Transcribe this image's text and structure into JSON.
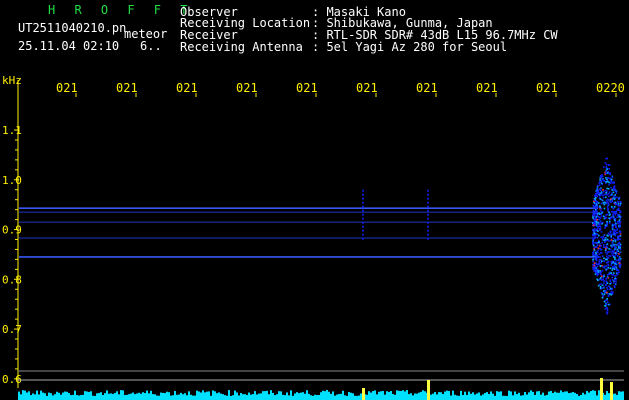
{
  "header": {
    "brand": "H R O F F T",
    "filename": "UT2511040210.pn",
    "kind": "meteor",
    "datetime": "25.11.04 02:10",
    "count": "6..",
    "info": [
      {
        "label": "Observer",
        "value": ": Masaki Kano"
      },
      {
        "label": "Receiving Location",
        "value": ": Shibukawa, Gunma, Japan"
      },
      {
        "label": "Receiver",
        "value": ": RTL-SDR SDR# 43dB L15 96.7MHz CW"
      },
      {
        "label": "Receiving Antenna",
        "value": ": 5el Yagi Az 280 for Seoul"
      }
    ]
  },
  "chart_data": {
    "type": "heatmap",
    "ylabel": "kHz",
    "ylim": [
      0.58,
      1.15
    ],
    "y_ticks": [
      "1.1",
      "1.0",
      "0.9",
      "0.8",
      "0.7",
      "0.6"
    ],
    "time_labels": [
      "021",
      "021",
      "021",
      "021",
      "021",
      "021",
      "021",
      "021",
      "021",
      "0220"
    ],
    "horizontal_lines_khz": [
      0.943,
      0.935,
      0.915,
      0.883,
      0.845
    ],
    "meteor_echoes": [
      {
        "label": "faint echo near 0216",
        "y_range_khz": [
          0.88,
          0.98
        ]
      },
      {
        "label": "faint echo near 0217",
        "y_range_khz": [
          0.88,
          0.98
        ]
      },
      {
        "label": "strong echo near 0220",
        "y_range_khz": [
          0.73,
          1.05
        ]
      }
    ],
    "colors": {
      "background": "#000000",
      "signal_low": "#1020ff",
      "signal_mid": "#00b0ff",
      "signal_high": "#ff3030",
      "axis": "#ffee00",
      "bottom_band": "#00e0ff"
    }
  }
}
